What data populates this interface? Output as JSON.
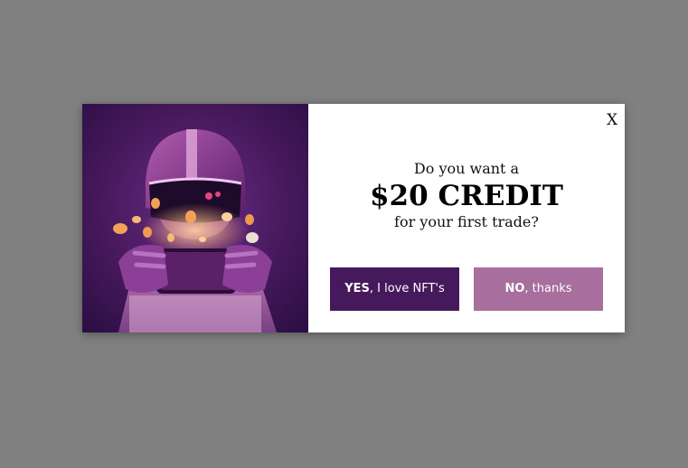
{
  "popup": {
    "close_label": "X",
    "line1": "Do you want a",
    "headline": "$20 CREDIT",
    "line3": "for your first trade?",
    "yes_button": {
      "strong": "YES",
      "rest": ", I love NFT's"
    },
    "no_button": {
      "strong": "NO",
      "rest": ", thanks"
    }
  },
  "colors": {
    "overlay": "#808080",
    "yes_button": "#46195c",
    "no_button": "#a76e9e",
    "hero_background": "#3a1558"
  }
}
